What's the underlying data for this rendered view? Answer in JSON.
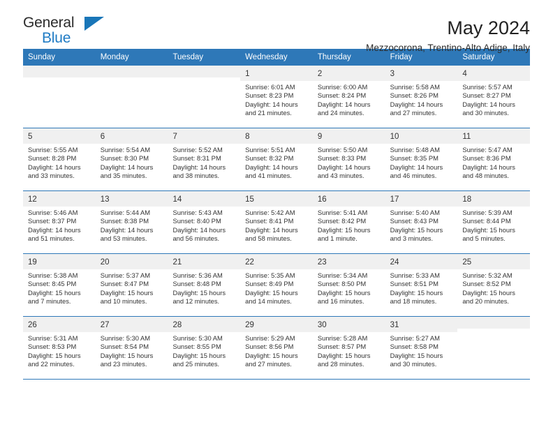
{
  "brand": {
    "name_top": "General",
    "name_bottom": "Blue",
    "icon": "triangle-flag-icon",
    "accent": "#1f7bc4"
  },
  "header": {
    "title": "May 2024",
    "subtitle": "Mezzocorona, Trentino-Alto Adige, Italy"
  },
  "colors": {
    "header_band": "#2e78b8",
    "daynum_band": "#f0f0f0",
    "row_rule": "#2e78b8",
    "text": "#333333"
  },
  "calendar": {
    "day_headers": [
      "Sunday",
      "Monday",
      "Tuesday",
      "Wednesday",
      "Thursday",
      "Friday",
      "Saturday"
    ],
    "labels": {
      "sunrise": "Sunrise:",
      "sunset": "Sunset:",
      "daylight": "Daylight:"
    },
    "weeks": [
      [
        {
          "day": ""
        },
        {
          "day": ""
        },
        {
          "day": ""
        },
        {
          "day": "1",
          "sunrise": "Sunrise: 6:01 AM",
          "sunset": "Sunset: 8:23 PM",
          "daylight_1": "Daylight: 14 hours",
          "daylight_2": "and 21 minutes."
        },
        {
          "day": "2",
          "sunrise": "Sunrise: 6:00 AM",
          "sunset": "Sunset: 8:24 PM",
          "daylight_1": "Daylight: 14 hours",
          "daylight_2": "and 24 minutes."
        },
        {
          "day": "3",
          "sunrise": "Sunrise: 5:58 AM",
          "sunset": "Sunset: 8:26 PM",
          "daylight_1": "Daylight: 14 hours",
          "daylight_2": "and 27 minutes."
        },
        {
          "day": "4",
          "sunrise": "Sunrise: 5:57 AM",
          "sunset": "Sunset: 8:27 PM",
          "daylight_1": "Daylight: 14 hours",
          "daylight_2": "and 30 minutes."
        }
      ],
      [
        {
          "day": "5",
          "sunrise": "Sunrise: 5:55 AM",
          "sunset": "Sunset: 8:28 PM",
          "daylight_1": "Daylight: 14 hours",
          "daylight_2": "and 33 minutes."
        },
        {
          "day": "6",
          "sunrise": "Sunrise: 5:54 AM",
          "sunset": "Sunset: 8:30 PM",
          "daylight_1": "Daylight: 14 hours",
          "daylight_2": "and 35 minutes."
        },
        {
          "day": "7",
          "sunrise": "Sunrise: 5:52 AM",
          "sunset": "Sunset: 8:31 PM",
          "daylight_1": "Daylight: 14 hours",
          "daylight_2": "and 38 minutes."
        },
        {
          "day": "8",
          "sunrise": "Sunrise: 5:51 AM",
          "sunset": "Sunset: 8:32 PM",
          "daylight_1": "Daylight: 14 hours",
          "daylight_2": "and 41 minutes."
        },
        {
          "day": "9",
          "sunrise": "Sunrise: 5:50 AM",
          "sunset": "Sunset: 8:33 PM",
          "daylight_1": "Daylight: 14 hours",
          "daylight_2": "and 43 minutes."
        },
        {
          "day": "10",
          "sunrise": "Sunrise: 5:48 AM",
          "sunset": "Sunset: 8:35 PM",
          "daylight_1": "Daylight: 14 hours",
          "daylight_2": "and 46 minutes."
        },
        {
          "day": "11",
          "sunrise": "Sunrise: 5:47 AM",
          "sunset": "Sunset: 8:36 PM",
          "daylight_1": "Daylight: 14 hours",
          "daylight_2": "and 48 minutes."
        }
      ],
      [
        {
          "day": "12",
          "sunrise": "Sunrise: 5:46 AM",
          "sunset": "Sunset: 8:37 PM",
          "daylight_1": "Daylight: 14 hours",
          "daylight_2": "and 51 minutes."
        },
        {
          "day": "13",
          "sunrise": "Sunrise: 5:44 AM",
          "sunset": "Sunset: 8:38 PM",
          "daylight_1": "Daylight: 14 hours",
          "daylight_2": "and 53 minutes."
        },
        {
          "day": "14",
          "sunrise": "Sunrise: 5:43 AM",
          "sunset": "Sunset: 8:40 PM",
          "daylight_1": "Daylight: 14 hours",
          "daylight_2": "and 56 minutes."
        },
        {
          "day": "15",
          "sunrise": "Sunrise: 5:42 AM",
          "sunset": "Sunset: 8:41 PM",
          "daylight_1": "Daylight: 14 hours",
          "daylight_2": "and 58 minutes."
        },
        {
          "day": "16",
          "sunrise": "Sunrise: 5:41 AM",
          "sunset": "Sunset: 8:42 PM",
          "daylight_1": "Daylight: 15 hours",
          "daylight_2": "and 1 minute."
        },
        {
          "day": "17",
          "sunrise": "Sunrise: 5:40 AM",
          "sunset": "Sunset: 8:43 PM",
          "daylight_1": "Daylight: 15 hours",
          "daylight_2": "and 3 minutes."
        },
        {
          "day": "18",
          "sunrise": "Sunrise: 5:39 AM",
          "sunset": "Sunset: 8:44 PM",
          "daylight_1": "Daylight: 15 hours",
          "daylight_2": "and 5 minutes."
        }
      ],
      [
        {
          "day": "19",
          "sunrise": "Sunrise: 5:38 AM",
          "sunset": "Sunset: 8:45 PM",
          "daylight_1": "Daylight: 15 hours",
          "daylight_2": "and 7 minutes."
        },
        {
          "day": "20",
          "sunrise": "Sunrise: 5:37 AM",
          "sunset": "Sunset: 8:47 PM",
          "daylight_1": "Daylight: 15 hours",
          "daylight_2": "and 10 minutes."
        },
        {
          "day": "21",
          "sunrise": "Sunrise: 5:36 AM",
          "sunset": "Sunset: 8:48 PM",
          "daylight_1": "Daylight: 15 hours",
          "daylight_2": "and 12 minutes."
        },
        {
          "day": "22",
          "sunrise": "Sunrise: 5:35 AM",
          "sunset": "Sunset: 8:49 PM",
          "daylight_1": "Daylight: 15 hours",
          "daylight_2": "and 14 minutes."
        },
        {
          "day": "23",
          "sunrise": "Sunrise: 5:34 AM",
          "sunset": "Sunset: 8:50 PM",
          "daylight_1": "Daylight: 15 hours",
          "daylight_2": "and 16 minutes."
        },
        {
          "day": "24",
          "sunrise": "Sunrise: 5:33 AM",
          "sunset": "Sunset: 8:51 PM",
          "daylight_1": "Daylight: 15 hours",
          "daylight_2": "and 18 minutes."
        },
        {
          "day": "25",
          "sunrise": "Sunrise: 5:32 AM",
          "sunset": "Sunset: 8:52 PM",
          "daylight_1": "Daylight: 15 hours",
          "daylight_2": "and 20 minutes."
        }
      ],
      [
        {
          "day": "26",
          "sunrise": "Sunrise: 5:31 AM",
          "sunset": "Sunset: 8:53 PM",
          "daylight_1": "Daylight: 15 hours",
          "daylight_2": "and 22 minutes."
        },
        {
          "day": "27",
          "sunrise": "Sunrise: 5:30 AM",
          "sunset": "Sunset: 8:54 PM",
          "daylight_1": "Daylight: 15 hours",
          "daylight_2": "and 23 minutes."
        },
        {
          "day": "28",
          "sunrise": "Sunrise: 5:30 AM",
          "sunset": "Sunset: 8:55 PM",
          "daylight_1": "Daylight: 15 hours",
          "daylight_2": "and 25 minutes."
        },
        {
          "day": "29",
          "sunrise": "Sunrise: 5:29 AM",
          "sunset": "Sunset: 8:56 PM",
          "daylight_1": "Daylight: 15 hours",
          "daylight_2": "and 27 minutes."
        },
        {
          "day": "30",
          "sunrise": "Sunrise: 5:28 AM",
          "sunset": "Sunset: 8:57 PM",
          "daylight_1": "Daylight: 15 hours",
          "daylight_2": "and 28 minutes."
        },
        {
          "day": "31",
          "sunrise": "Sunrise: 5:27 AM",
          "sunset": "Sunset: 8:58 PM",
          "daylight_1": "Daylight: 15 hours",
          "daylight_2": "and 30 minutes."
        },
        {
          "day": ""
        }
      ]
    ]
  }
}
